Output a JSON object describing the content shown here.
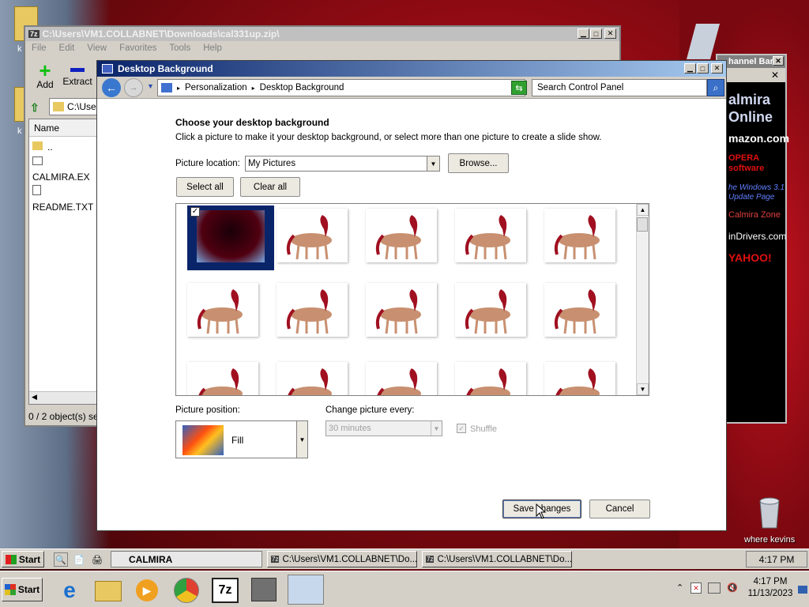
{
  "desktop": {
    "folder1_label": "k",
    "folder2_label": "k",
    "recycle_label": "where kevins"
  },
  "zip_window": {
    "title": "C:\\Users\\VM1.COLLABNET\\Downloads\\cal331up.zip\\",
    "menu": [
      "File",
      "Edit",
      "View",
      "Favorites",
      "Tools",
      "Help"
    ],
    "add_label": "Add",
    "extract_label": "Extract",
    "path": "C:\\Use",
    "name_header": "Name",
    "files": [
      "..",
      "CALMIRA.EX",
      "README.TXT"
    ],
    "status": "0 / 2 object(s) se"
  },
  "channel_bar": {
    "title": "hannel Bar",
    "items": [
      "almira Online",
      "mazon.com",
      "OPERA software",
      "he Windows 3.1 Update Page",
      "Calmira Zone",
      "inDrivers.com",
      "YAHOO!"
    ]
  },
  "dialog": {
    "title": "Desktop Background",
    "breadcrumb": [
      "Personalization",
      "Desktop Background"
    ],
    "search_placeholder": "Search Control Panel",
    "heading": "Choose your desktop background",
    "instructions": "Click a picture to make it your desktop background, or select more than one picture to create a slide show.",
    "picture_location_label": "Picture location:",
    "picture_location_value": "My Pictures",
    "browse_label": "Browse...",
    "select_all_label": "Select all",
    "clear_all_label": "Clear all",
    "picture_position_label": "Picture position:",
    "picture_position_value": "Fill",
    "change_every_label": "Change picture every:",
    "change_every_value": "30 minutes",
    "shuffle_label": "Shuffle",
    "save_label": "Save changes",
    "cancel_label": "Cancel"
  },
  "taskbar1": {
    "start_label": "Start",
    "calmira_label": "CALMIRA",
    "task1": "C:\\Users\\VM1.COLLABNET\\Do...",
    "task2": "C:\\Users\\VM1.COLLABNET\\Do...",
    "clock": "4:17 PM"
  },
  "taskbar2": {
    "start_label": "Start",
    "time": "4:17 PM",
    "date": "11/13/2023"
  }
}
